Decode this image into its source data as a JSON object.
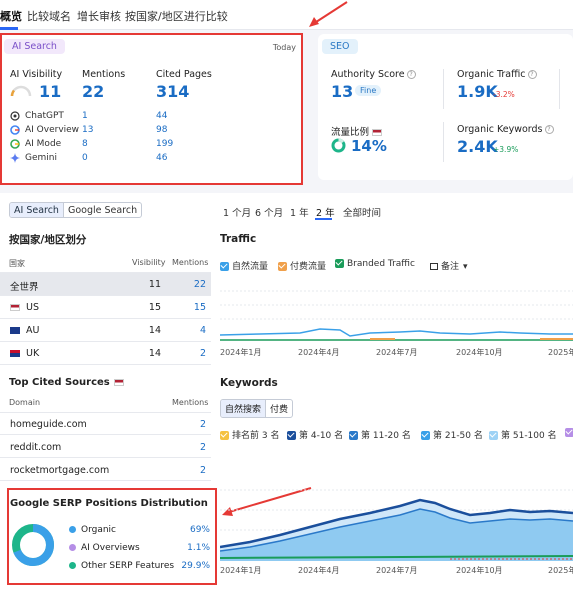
{
  "top_nav": {
    "tabs": [
      "概览",
      "比较域名",
      "增长审核",
      "按国家/地区进行比较"
    ]
  },
  "ai_search": {
    "badge": "AI Search",
    "date": "Today",
    "visibility_label": "AI Visibility",
    "visibility_value": "11",
    "mentions_label": "Mentions",
    "mentions_value": "22",
    "cited_pages_label": "Cited Pages",
    "cited_pages_value": "314",
    "platforms": [
      {
        "name": "ChatGPT",
        "mentions": "1",
        "cited": "44"
      },
      {
        "name": "AI Overview",
        "mentions": "13",
        "cited": "98"
      },
      {
        "name": "AI Mode",
        "mentions": "8",
        "cited": "199"
      },
      {
        "name": "Gemini",
        "mentions": "0",
        "cited": "46"
      }
    ]
  },
  "seo": {
    "badge": "SEO",
    "authority_label": "Authority Score",
    "authority_value": "13",
    "authority_tag": "Fine",
    "organic_traffic_label": "Organic Traffic",
    "organic_traffic_value": "1.9K",
    "organic_traffic_change": "-3.2%",
    "flow_ratio_label": "流量比例",
    "flow_ratio_value": "14%",
    "organic_keywords_label": "Organic Keywords",
    "organic_keywords_value": "2.4K",
    "organic_keywords_change": "+3.9%"
  },
  "segment": {
    "ai_search": "AI Search",
    "google_search": "Google Search"
  },
  "periods": [
    "1 个月",
    "6 个月",
    "1 年",
    "2 年",
    "全部时间"
  ],
  "geo": {
    "title": "按国家/地区划分",
    "col_country": "国家",
    "col_visibility": "Visibility",
    "col_mentions": "Mentions",
    "rows": [
      {
        "name": "全世界",
        "visibility": "11",
        "mentions": "22"
      },
      {
        "name": "US",
        "visibility": "15",
        "mentions": "15"
      },
      {
        "name": "AU",
        "visibility": "14",
        "mentions": "4"
      },
      {
        "name": "UK",
        "visibility": "14",
        "mentions": "2"
      }
    ]
  },
  "sources": {
    "title": "Top Cited Sources",
    "col_domain": "Domain",
    "col_mentions": "Mentions",
    "rows": [
      {
        "domain": "homeguide.com",
        "mentions": "2"
      },
      {
        "domain": "reddit.com",
        "mentions": "2"
      },
      {
        "domain": "rocketmortgage.com",
        "mentions": "2"
      }
    ]
  },
  "serp": {
    "title": "Google SERP Positions Distribution",
    "items": [
      {
        "label": "Organic",
        "value": "69%",
        "color": "#3aa0e8"
      },
      {
        "label": "AI Overviews",
        "value": "1.1%",
        "color": "#b58ee6"
      },
      {
        "label": "Other SERP Features",
        "value": "29.9%",
        "color": "#1db58a"
      }
    ]
  },
  "traffic": {
    "title": "Traffic",
    "legend": [
      "自然流量",
      "付费流量",
      "Branded Traffic",
      "备注"
    ],
    "x_labels": [
      "2024年1月",
      "2024年4月",
      "2024年7月",
      "2024年10月",
      "2025年"
    ]
  },
  "keywords": {
    "title": "Keywords",
    "tabs": [
      "自然搜索",
      "付费"
    ],
    "legend": [
      "排名前 3 名",
      "第 4-10 名",
      "第 11-20 名",
      "第 21-50 名",
      "第 51-100 名"
    ],
    "x_labels": [
      "2024年1月",
      "2024年4月",
      "2024年7月",
      "2024年10月",
      "2025年"
    ]
  },
  "colors": {
    "accent": "#2a67f5",
    "annotation_red": "#e53935",
    "link_blue": "#1a6cc4"
  }
}
